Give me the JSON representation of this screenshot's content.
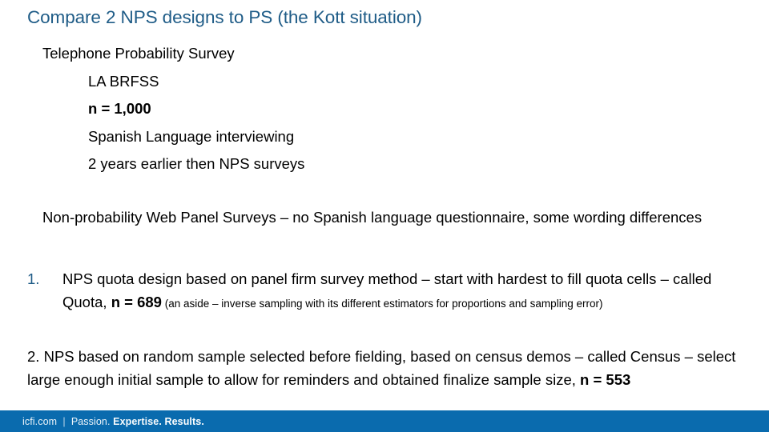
{
  "slide": {
    "title": "Compare 2 NPS designs to PS (the Kott situation)",
    "title_color": "#1F5C87",
    "background_color": "#FFFFFF"
  },
  "outline": {
    "level1_item": "Telephone Probability Survey",
    "level2_items": [
      {
        "text": "LA BRFSS",
        "bold": false
      },
      {
        "text": "n = 1,000",
        "bold": true
      },
      {
        "text": "Spanish Language interviewing",
        "bold": false
      },
      {
        "text": "2 years earlier then NPS surveys",
        "bold": false
      }
    ]
  },
  "paragraphs": {
    "non_probability": "Non-probability Web Panel Surveys – no Spanish language questionnaire, some wording differences"
  },
  "numbered_items": [
    {
      "marker": "1.",
      "marker_color": "#1F5C87",
      "text_before_bold": "NPS quota design based on panel firm survey method – start with hardest to fill quota cells – called Quota, ",
      "bold_value": "n = 689",
      "aside": " (an aside – inverse sampling with its different estimators for proportions and sampling error)"
    },
    {
      "marker": "2.",
      "marker_color": "#000000",
      "text_before_bold": "NPS based on random sample selected before fielding, based on census demos – called Census – select large enough initial sample to allow for reminders and obtained finalize sample size, ",
      "bold_value": "n = 553",
      "aside": ""
    }
  ],
  "footer": {
    "background_color": "#0A6BAE",
    "site": "icfi.com",
    "separator": "  |  ",
    "word_passion": "Passion. ",
    "word_expertise": "Expertise. ",
    "word_results": "Results."
  }
}
